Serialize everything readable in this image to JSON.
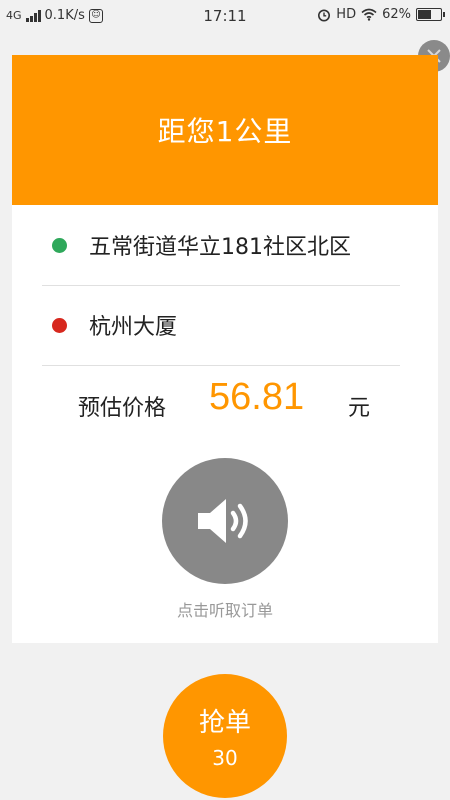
{
  "status_bar": {
    "network": "4G",
    "speed": "0.1K/s",
    "app_icon_glyph": "☺",
    "time": "17:11",
    "hd": "HD",
    "battery_percent": "62%",
    "battery_level": 0.62
  },
  "order": {
    "distance": "距您1公里",
    "start_address": "五常街道华立181社区北区",
    "end_address": "杭州大厦",
    "price_label": "预估价格",
    "price_value": "56.81",
    "price_unit": "元",
    "listen_label": "点击听取订单",
    "grab_label": "抢单",
    "grab_countdown": "30"
  },
  "colors": {
    "accent": "#ff9600",
    "start_dot": "#2fa85b",
    "end_dot": "#d7281e",
    "speaker_bg": "#888888"
  },
  "icons": {
    "close": "close-icon",
    "speaker": "speaker-icon",
    "alarm": "alarm-icon",
    "wifi": "wifi-icon",
    "signal": "signal-icon",
    "battery": "battery-icon"
  }
}
